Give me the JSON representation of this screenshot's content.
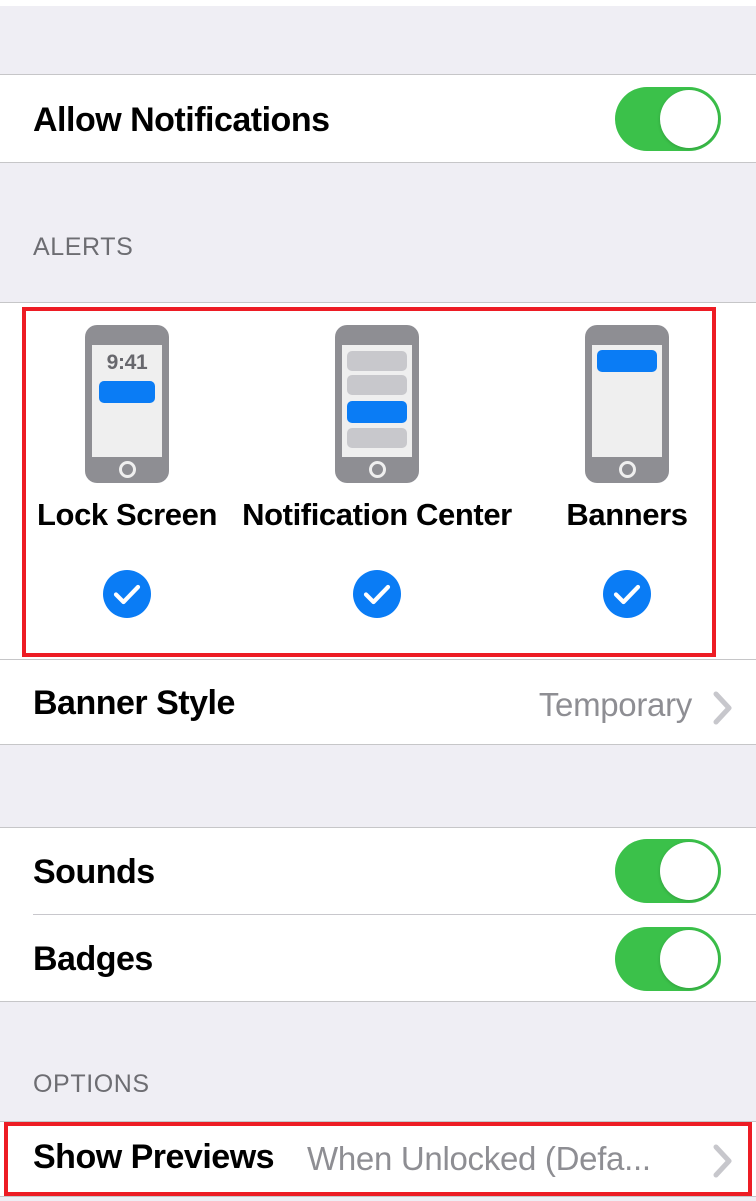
{
  "colors": {
    "toggle_on": "#3BC14A",
    "accent_blue": "#0A7CF5",
    "highlight_red": "#ED1C24",
    "group_bg": "#EFEEF4",
    "secondary_text": "#8E8E93",
    "header_text": "#6D6D72"
  },
  "rows": {
    "allow_notifications": {
      "label": "Allow Notifications",
      "toggle_state": "on"
    },
    "banner_style": {
      "label": "Banner Style",
      "value": "Temporary"
    },
    "sounds": {
      "label": "Sounds",
      "toggle_state": "on"
    },
    "badges": {
      "label": "Badges",
      "toggle_state": "on"
    },
    "show_previews": {
      "label": "Show Previews",
      "value": "When Unlocked (Defa..."
    }
  },
  "sections": {
    "alerts_header": "ALERTS",
    "options_header": "OPTIONS"
  },
  "alerts": {
    "options": [
      {
        "label": "Lock Screen",
        "selected": true,
        "preview_time": "9:41"
      },
      {
        "label": "Notification Center",
        "selected": true,
        "preview_time": ""
      },
      {
        "label": "Banners",
        "selected": true,
        "preview_time": ""
      }
    ]
  }
}
